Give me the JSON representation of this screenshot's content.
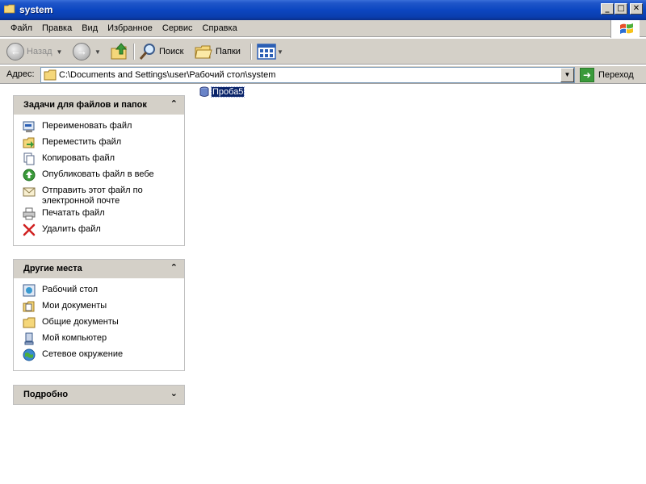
{
  "window": {
    "title": "system",
    "buttons": {
      "minimize": "_",
      "maximize": "□",
      "close": "✕"
    }
  },
  "menu": [
    "Файл",
    "Правка",
    "Вид",
    "Избранное",
    "Сервис",
    "Справка"
  ],
  "toolbar": {
    "back_label": "Назад",
    "search_label": "Поиск",
    "folders_label": "Папки"
  },
  "address": {
    "label": "Адрес:",
    "value": "C:\\Documents and Settings\\user\\Рабочий стол\\system",
    "go_label": "Переход"
  },
  "tasks_panel": {
    "title": "Задачи для файлов и папок",
    "items": [
      {
        "label": "Переименовать файл",
        "icon": "rename-icon"
      },
      {
        "label": "Переместить файл",
        "icon": "move-icon"
      },
      {
        "label": "Копировать файл",
        "icon": "copy-icon"
      },
      {
        "label": "Опубликовать файл в вебе",
        "icon": "publish-web-icon"
      },
      {
        "label": "Отправить этот файл по электронной почте",
        "icon": "email-icon"
      },
      {
        "label": "Печатать файл",
        "icon": "print-icon"
      },
      {
        "label": "Удалить файл",
        "icon": "delete-icon"
      }
    ]
  },
  "places_panel": {
    "title": "Другие места",
    "items": [
      {
        "label": "Рабочий стол",
        "icon": "desktop-icon"
      },
      {
        "label": "Мои документы",
        "icon": "my-documents-icon"
      },
      {
        "label": "Общие документы",
        "icon": "shared-documents-icon"
      },
      {
        "label": "Мой компьютер",
        "icon": "my-computer-icon"
      },
      {
        "label": "Сетевое окружение",
        "icon": "network-icon"
      }
    ]
  },
  "details_panel": {
    "title": "Подробно"
  },
  "files": [
    {
      "name": "Проба5",
      "selected": true
    }
  ],
  "colors": {
    "titlebar": "#0c46c0",
    "chrome": "#d4d0c8",
    "selection": "#0a246a"
  }
}
